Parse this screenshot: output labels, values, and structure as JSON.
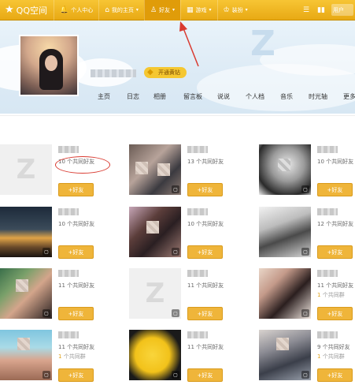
{
  "topbar": {
    "brand": "QQ空间",
    "items": [
      {
        "label": "个人中心",
        "icon": "bell-icon"
      },
      {
        "label": "我的主页",
        "icon": "home-icon"
      },
      {
        "label": "好友",
        "icon": "friends-icon",
        "active": true
      },
      {
        "label": "游戏",
        "icon": "grid-icon"
      },
      {
        "label": "装扮",
        "icon": "shirt-icon"
      }
    ],
    "user": "用户"
  },
  "profile": {
    "vip_badge": "开通黄钻"
  },
  "subnav": {
    "tabs": [
      "主页",
      "日志",
      "相册",
      "留言板",
      "说说",
      "个人档",
      "音乐",
      "时光轴",
      "更多"
    ]
  },
  "friends": [
    {
      "mutual": "10 个共同好友",
      "group": "",
      "add": "+好友"
    },
    {
      "mutual": "13 个共同好友",
      "group": "",
      "add": "+好友"
    },
    {
      "mutual": "10 个共同好友",
      "group": "",
      "add": "+好友"
    },
    {
      "mutual": "10 个共同好友",
      "group": "",
      "add": "+好友"
    },
    {
      "mutual": "10 个共同好友",
      "group": "",
      "add": "+好友"
    },
    {
      "mutual": "12 个共同好友",
      "group": "",
      "add": "+好友"
    },
    {
      "mutual": "11 个共同好友",
      "group": "",
      "add": "+好友"
    },
    {
      "mutual": "11 个共同好友",
      "group": "",
      "add": "+好友"
    },
    {
      "mutual": "11 个共同好友",
      "group_count": "1",
      "group_suffix": "个共同群",
      "add": "+好友"
    },
    {
      "mutual": "11 个共同好友",
      "group_count": "1",
      "group_suffix": "个共同群",
      "add": "+好友"
    },
    {
      "mutual": "11 个共同好友",
      "group": "",
      "add": "+好友"
    },
    {
      "mutual": "9 个共同好友",
      "group_count": "1",
      "group_suffix": "个共同群",
      "add": "+好友"
    }
  ]
}
